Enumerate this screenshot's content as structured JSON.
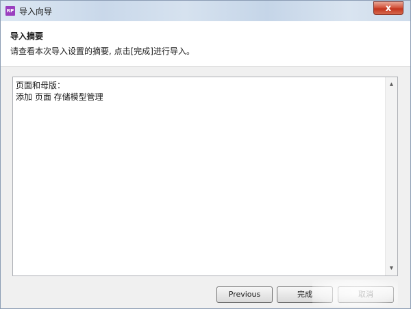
{
  "window": {
    "title": "导入向导",
    "app_icon_text": "RP",
    "close_label": "x"
  },
  "header": {
    "title": "导入摘要",
    "description": "请查看本次导入设置的摘要, 点击[完成]进行导入。"
  },
  "summary": {
    "lines": [
      "页面和母版：",
      "添加 页面 存储模型管理"
    ]
  },
  "buttons": {
    "previous_label": "Previous",
    "finish_label": "完成",
    "cancel_label": "取消"
  },
  "icons": {
    "scroll_up": "scroll-up-arrow",
    "scroll_down": "scroll-down-arrow"
  }
}
